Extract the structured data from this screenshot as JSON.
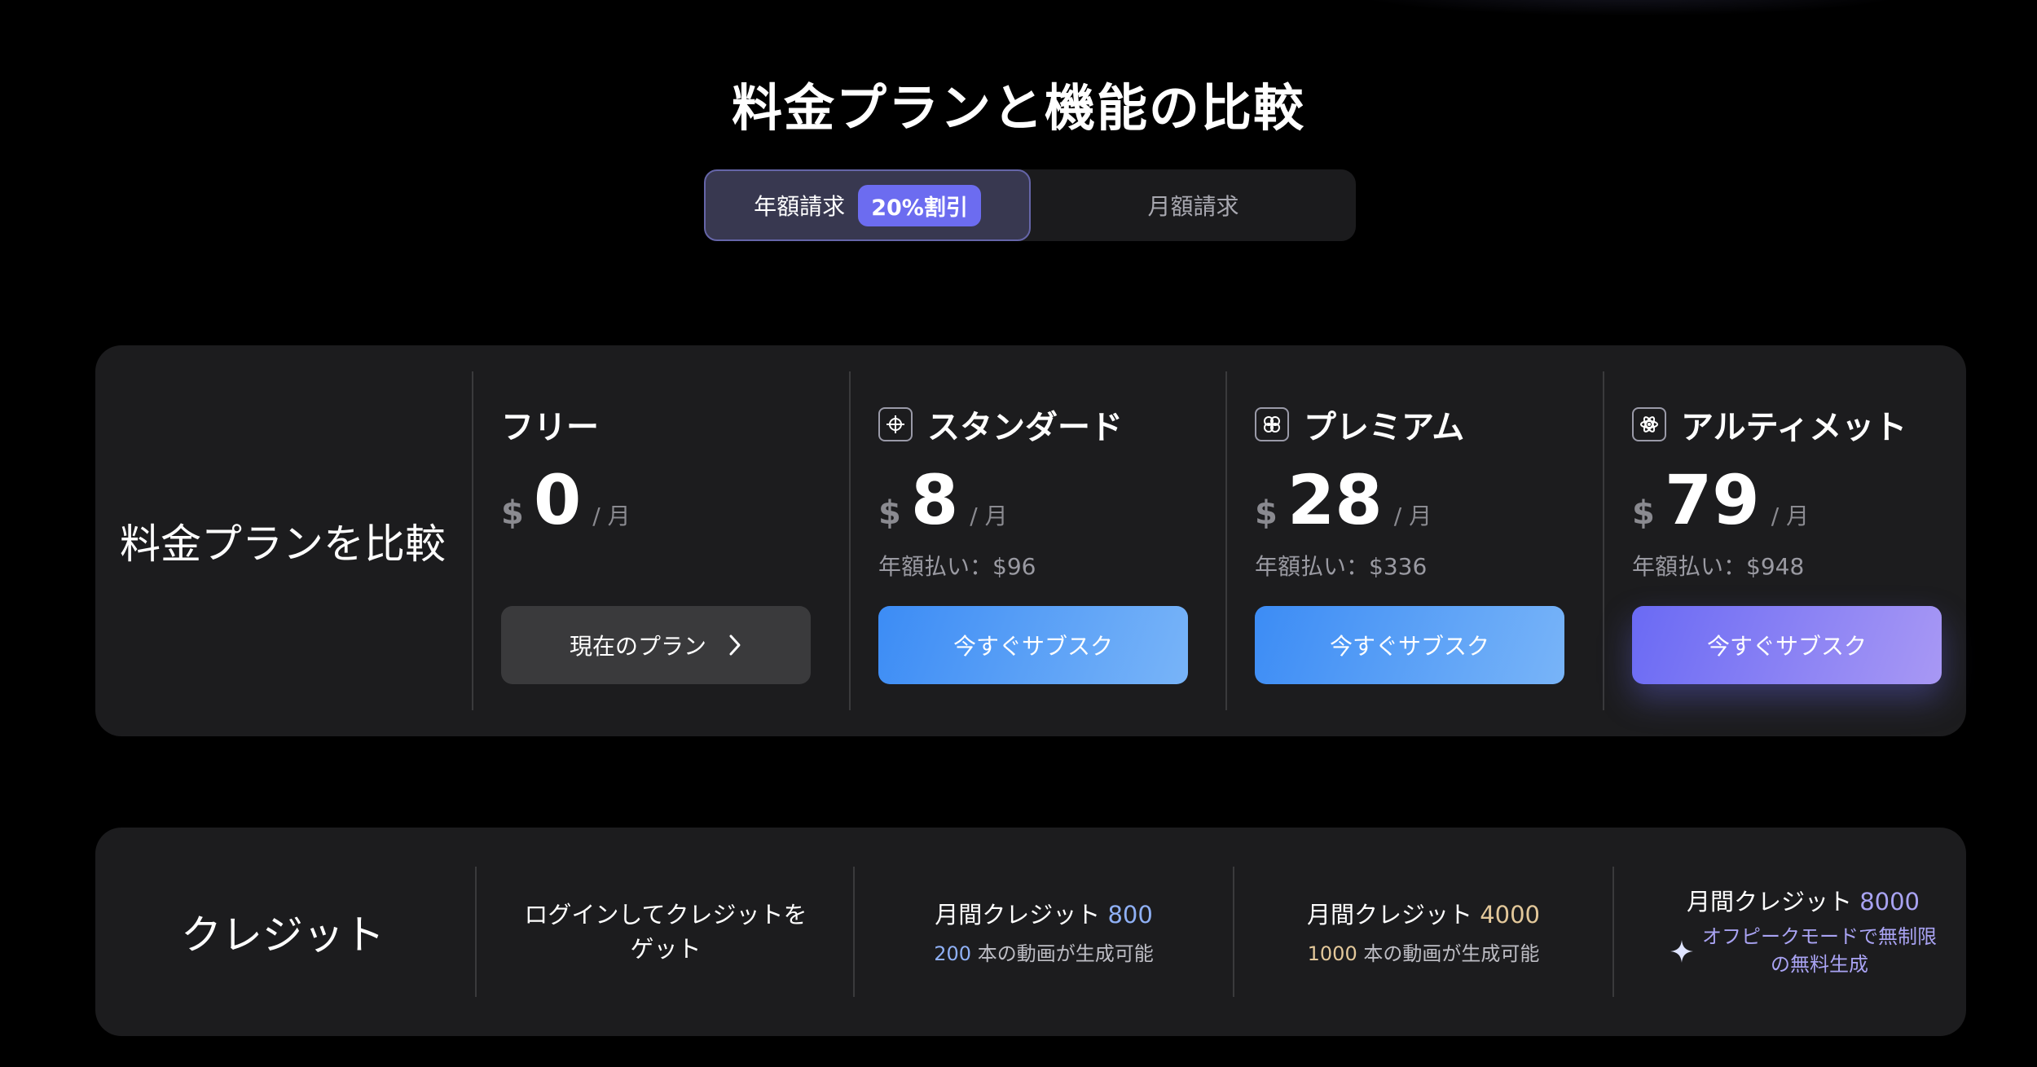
{
  "header": {
    "title": "料金プランと機能の比較"
  },
  "billing_toggle": {
    "annual_label": "年額請求",
    "discount_badge": "20%割引",
    "monthly_label": "月額請求"
  },
  "plans_row": {
    "label": "料金プランを比較",
    "plans": [
      {
        "name": "フリー",
        "currency": "$",
        "price": "0",
        "period": "/ 月",
        "annual": "",
        "button": "現在のプラン",
        "icon": ""
      },
      {
        "name": "スタンダード",
        "currency": "$",
        "price": "8",
        "period": "/ 月",
        "annual": "年額払い：$96",
        "button": "今すぐサブスク",
        "icon": "standard-plan-icon"
      },
      {
        "name": "プレミアム",
        "currency": "$",
        "price": "28",
        "period": "/ 月",
        "annual": "年額払い：$336",
        "button": "今すぐサブスク",
        "icon": "premium-plan-icon"
      },
      {
        "name": "アルティメット",
        "currency": "$",
        "price": "79",
        "period": "/ 月",
        "annual": "年額払い：$948",
        "button": "今すぐサブスク",
        "icon": "ultimate-plan-icon"
      }
    ]
  },
  "credits_row": {
    "label": "クレジット",
    "free": {
      "line1": "ログインしてクレジットを",
      "line2": "ゲット"
    },
    "standard": {
      "prefix": "月間クレジット",
      "amount": "800",
      "videos": "200",
      "videos_suffix": "本の動画が生成可能"
    },
    "premium": {
      "prefix": "月間クレジット",
      "amount": "4000",
      "videos": "1000",
      "videos_suffix": "本の動画が生成可能"
    },
    "ultimate": {
      "prefix": "月間クレジット",
      "amount": "8000",
      "offpeak_line1": "オフピークモードで無制限",
      "offpeak_line2": "の無料生成"
    }
  },
  "colors": {
    "accent_blue": "#3c8cf5",
    "accent_purple": "#6a6af4",
    "highlight_gold": "#e3c89a",
    "card_bg": "#1c1c1e"
  }
}
